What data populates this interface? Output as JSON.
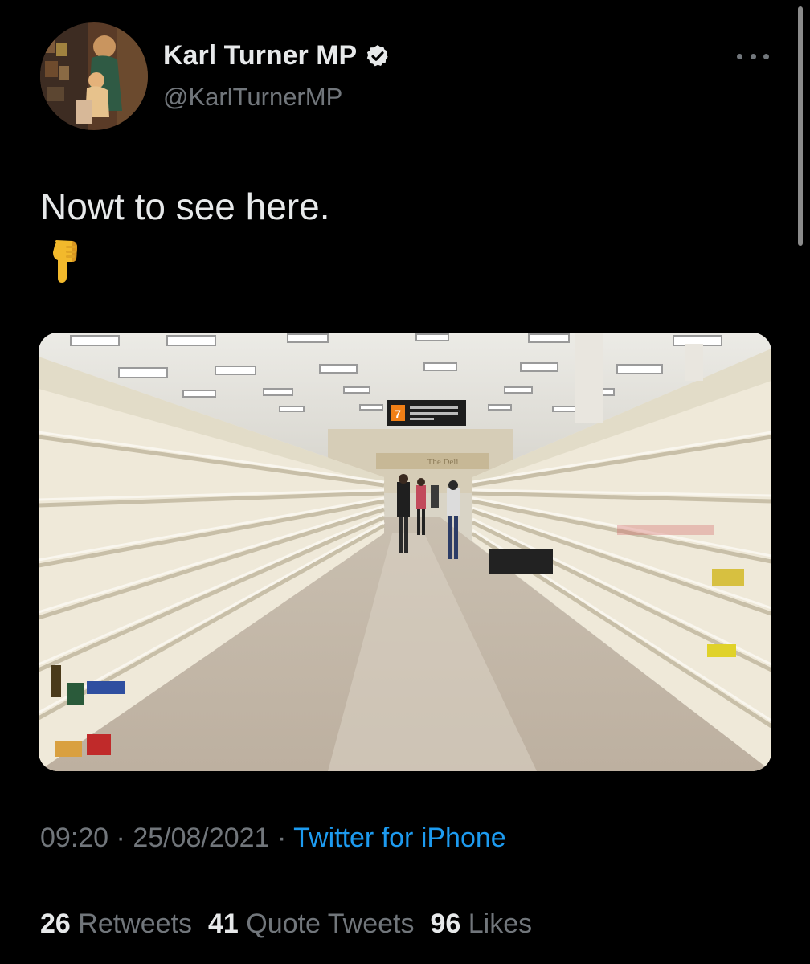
{
  "author": {
    "display_name": "Karl Turner MP",
    "handle": "@KarlTurnerMP",
    "verified_icon": "verified-badge-icon",
    "avatar": "profile-photo-avatar"
  },
  "menu": {
    "icon": "more-options-icon"
  },
  "tweet": {
    "text": "Nowt to see here.",
    "emoji": "👇",
    "media": {
      "kind": "photo",
      "aisle_sign_number": "7",
      "deli_sign": "The Deli"
    }
  },
  "meta": {
    "time": "09:20",
    "date": "25/08/2021",
    "separator": "·",
    "source": "Twitter for iPhone"
  },
  "stats": {
    "retweets_count": "26",
    "retweets_label": "Retweets",
    "quotes_count": "41",
    "quotes_label": "Quote Tweets",
    "likes_count": "96",
    "likes_label": "Likes"
  },
  "colors": {
    "background": "#000000",
    "primary_text": "#e7e9ea",
    "secondary_text": "#71767b",
    "link": "#1d9bf0",
    "divider": "#2f3336"
  }
}
